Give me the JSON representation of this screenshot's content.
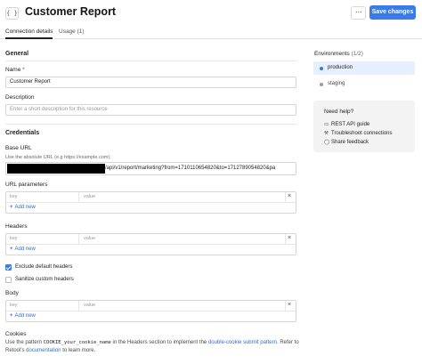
{
  "header": {
    "icon_glyph": "{ }",
    "title": "Customer Report",
    "more_label": "···",
    "save_label": "Save changes"
  },
  "tabs": [
    {
      "label": "Connection details",
      "active": true
    },
    {
      "label": "Usage (1)",
      "active": false
    }
  ],
  "general": {
    "title": "General",
    "name_label": "Name",
    "name_required": "*",
    "name_value": "Customer Report",
    "description_label": "Description",
    "description_placeholder": "Enter a short description for this resource"
  },
  "credentials": {
    "title": "Credentials",
    "base_url_label": "Base URL",
    "base_url_hint": "Use the absolute URL (e.g https://example.com).",
    "base_url_value": "/api/v1/report/marketing?from=1710110654820&to=1712789054820&pa",
    "url_params_label": "URL parameters",
    "key_placeholder": "key",
    "value_placeholder": "value",
    "add_new": "Add new",
    "remove_glyph": "×",
    "headers_label": "Headers",
    "exclude_default_headers": {
      "label": "Exclude default headers",
      "checked": true
    },
    "sanitize_custom_headers": {
      "label": "Sanitize custom headers",
      "checked": false
    },
    "body_label": "Body",
    "cookies_label": "Cookies",
    "cookies_text_1": "Use the pattern ",
    "cookies_code": "COOKIE_your_cookie_name",
    "cookies_text_2": " in the Headers section to implement the ",
    "cookies_link_1": "double-cookie submit pattern",
    "cookies_text_3": ". Refer to Retool's ",
    "cookies_link_2": "documentation",
    "cookies_text_4": " to learn more."
  },
  "sidebar": {
    "environments_title": "Environments",
    "environments_count": "(1/2)",
    "environments": [
      {
        "label": "production",
        "active": true,
        "dot_color": "#3a7be9"
      },
      {
        "label": "staging",
        "active": false,
        "dot_color": "#9a9a9a"
      }
    ],
    "help": {
      "title": "Need help?",
      "items": [
        {
          "label": "REST API guide",
          "icon": "book-icon",
          "glyph": "▭"
        },
        {
          "label": "Troubleshoot connections",
          "icon": "wrench-icon",
          "glyph": "⚒"
        },
        {
          "label": "Share feedback",
          "icon": "chat-bubble-icon",
          "glyph": "◯"
        }
      ]
    }
  },
  "colors": {
    "accent": "#3a7be9",
    "link": "#2a6fd6",
    "env_active_bg": "#e6effd"
  }
}
